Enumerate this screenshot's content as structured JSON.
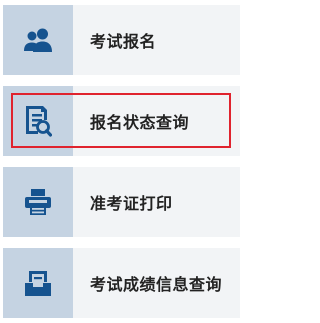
{
  "menu": {
    "items": [
      {
        "label": "考试报名",
        "icon": "users-icon"
      },
      {
        "label": "报名状态查询",
        "icon": "document-search-icon"
      },
      {
        "label": "准考证打印",
        "icon": "printer-icon"
      },
      {
        "label": "考试成绩信息查询",
        "icon": "inbox-tray-icon"
      }
    ],
    "highlighted_index": 1
  },
  "colors": {
    "icon_fill": "#16538f",
    "icon_bg": "#c5d3e2",
    "item_bg": "#f2f4f6",
    "highlight_border": "#e0232e",
    "label_text": "#222222"
  }
}
